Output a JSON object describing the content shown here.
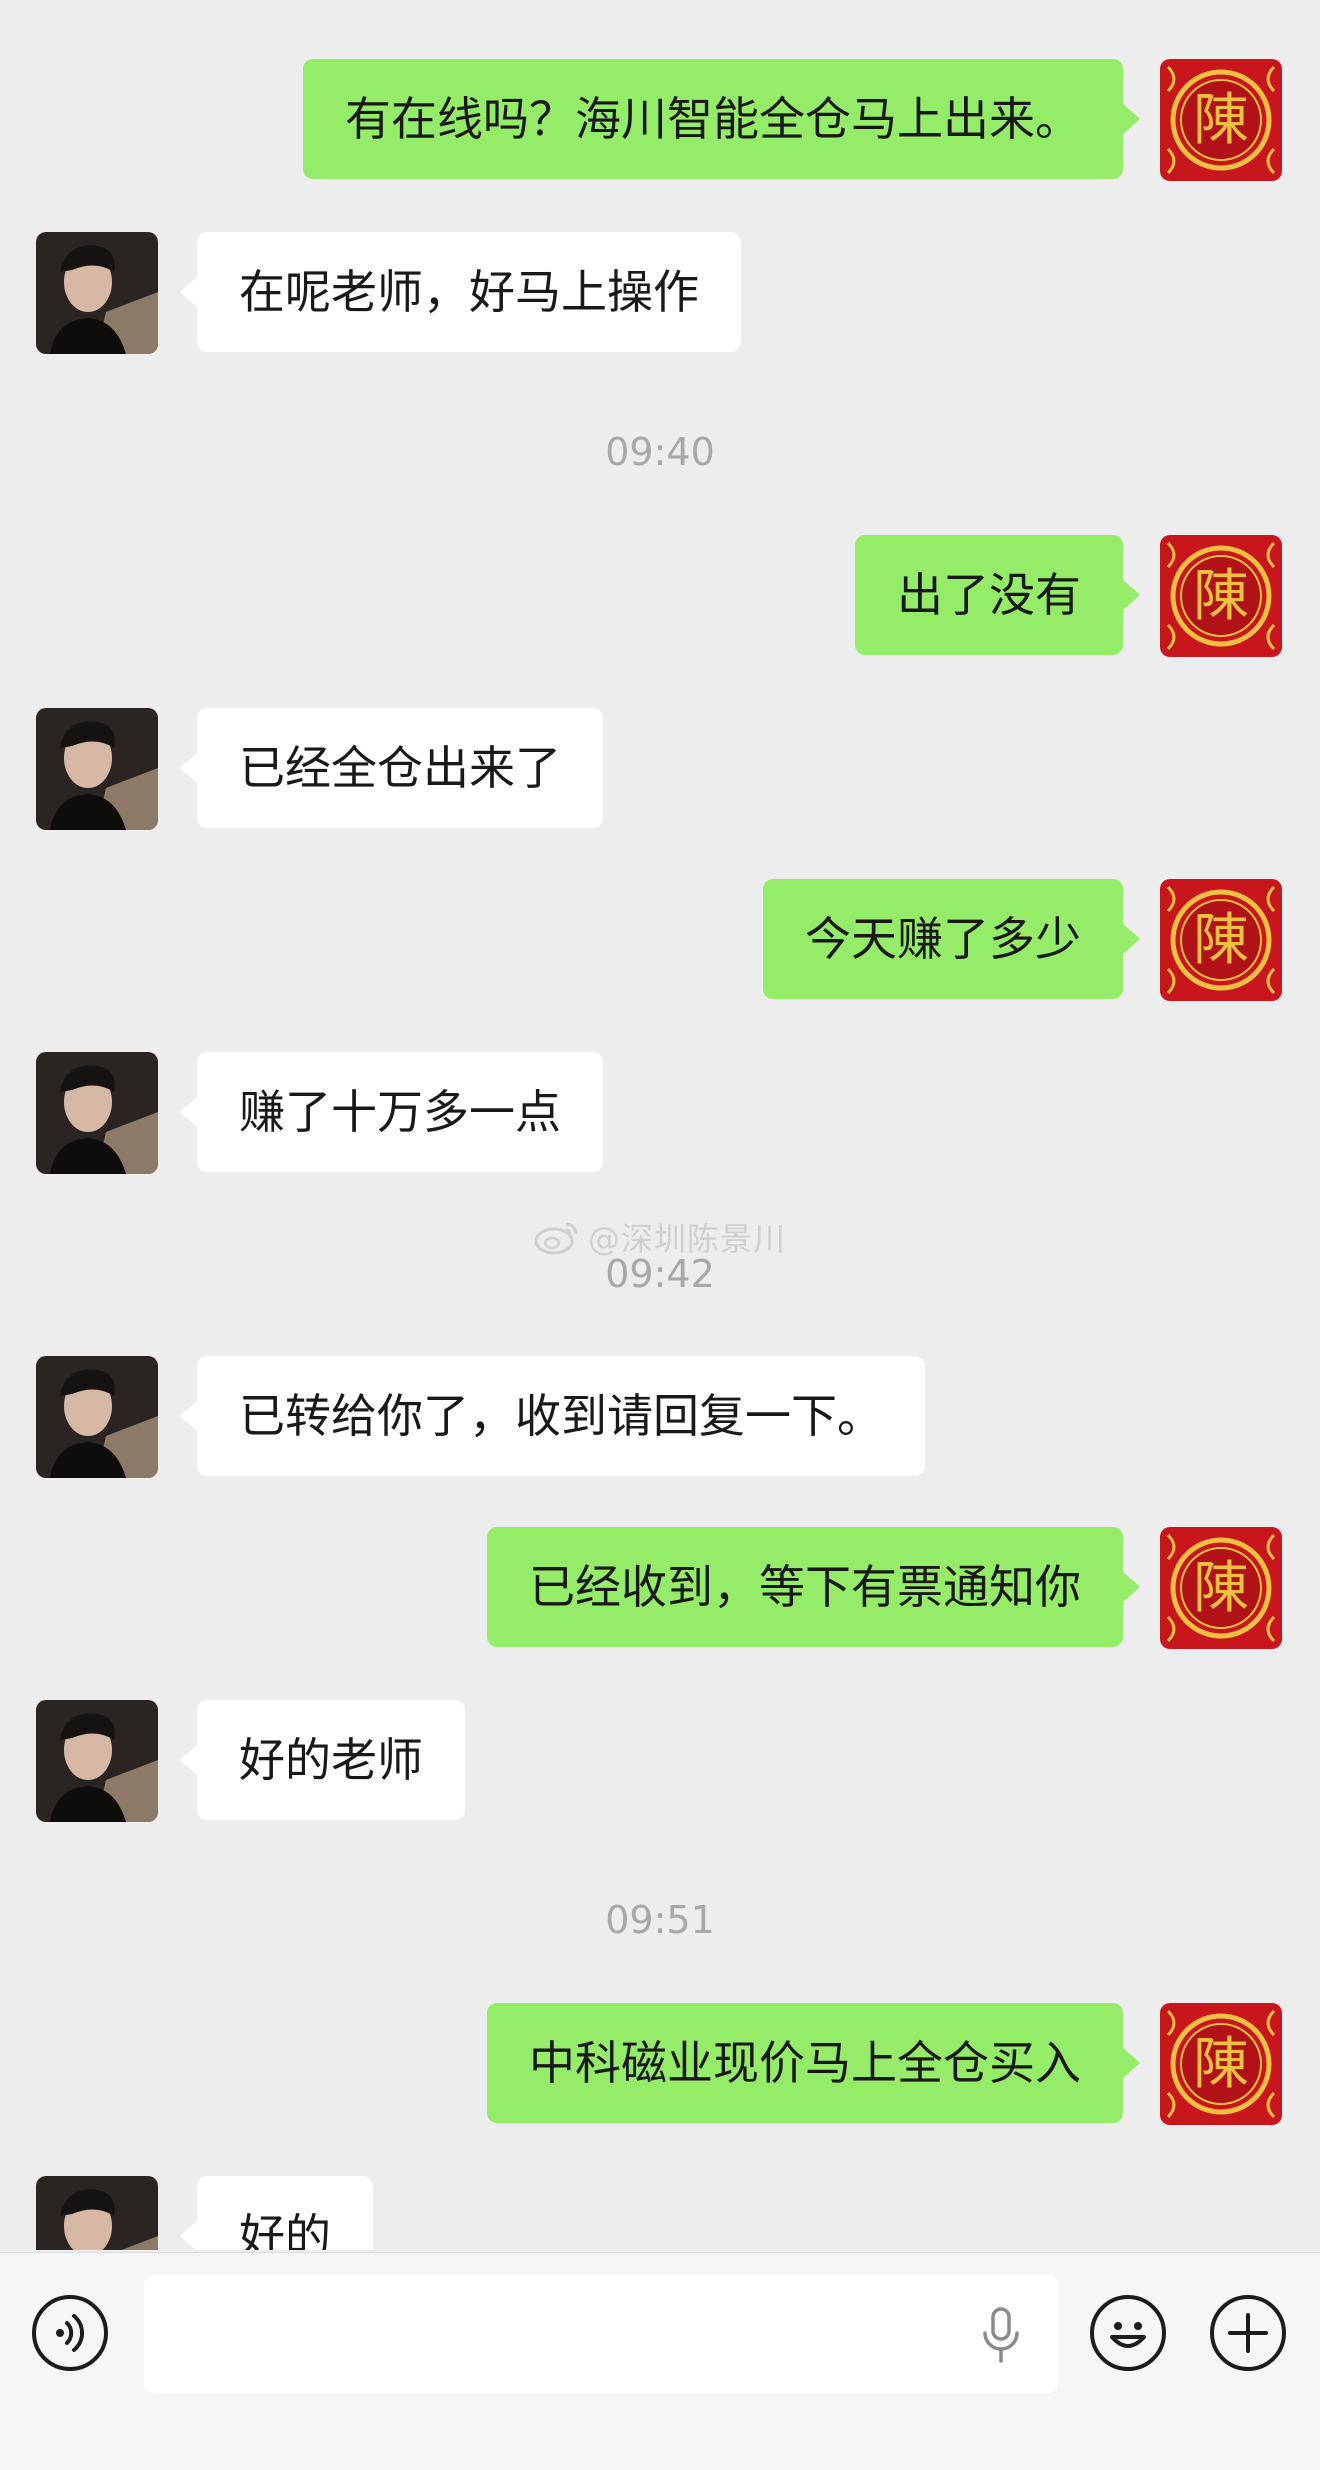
{
  "messages": [
    {
      "side": "self",
      "text": "有在线吗？海川智能全仓马上出来。"
    },
    {
      "side": "other",
      "text": "在呢老师，好马上操作"
    },
    {
      "side": "self",
      "text": "出了没有"
    },
    {
      "side": "other",
      "text": "已经全仓出来了"
    },
    {
      "side": "self",
      "text": "今天赚了多少"
    },
    {
      "side": "other",
      "text": "赚了十万多一点"
    },
    {
      "side": "other",
      "text": "已转给你了，收到请回复一下。"
    },
    {
      "side": "self",
      "text": "已经收到，等下有票通知你"
    },
    {
      "side": "other",
      "text": "好的老师"
    },
    {
      "side": "self",
      "text": "中科磁业现价马上全仓买入"
    },
    {
      "side": "other",
      "text": "好的"
    }
  ],
  "timestamps": [
    "09:40",
    "09:42",
    "09:51"
  ],
  "watermark": "@深圳陈景川",
  "self_avatar": {
    "icon": "seal-avatar-icon",
    "glyph": "陳",
    "color": "#c8161d",
    "accent": "#f0c040"
  },
  "colors": {
    "self_bubble": "#95ec69",
    "other_bubble": "#ffffff",
    "background": "#ededed"
  },
  "input_bar": {
    "voice_icon": "voice-mode-icon",
    "mic_icon": "microphone-icon",
    "emoji_icon": "emoji-icon",
    "more_icon": "plus-icon",
    "text_value": ""
  }
}
